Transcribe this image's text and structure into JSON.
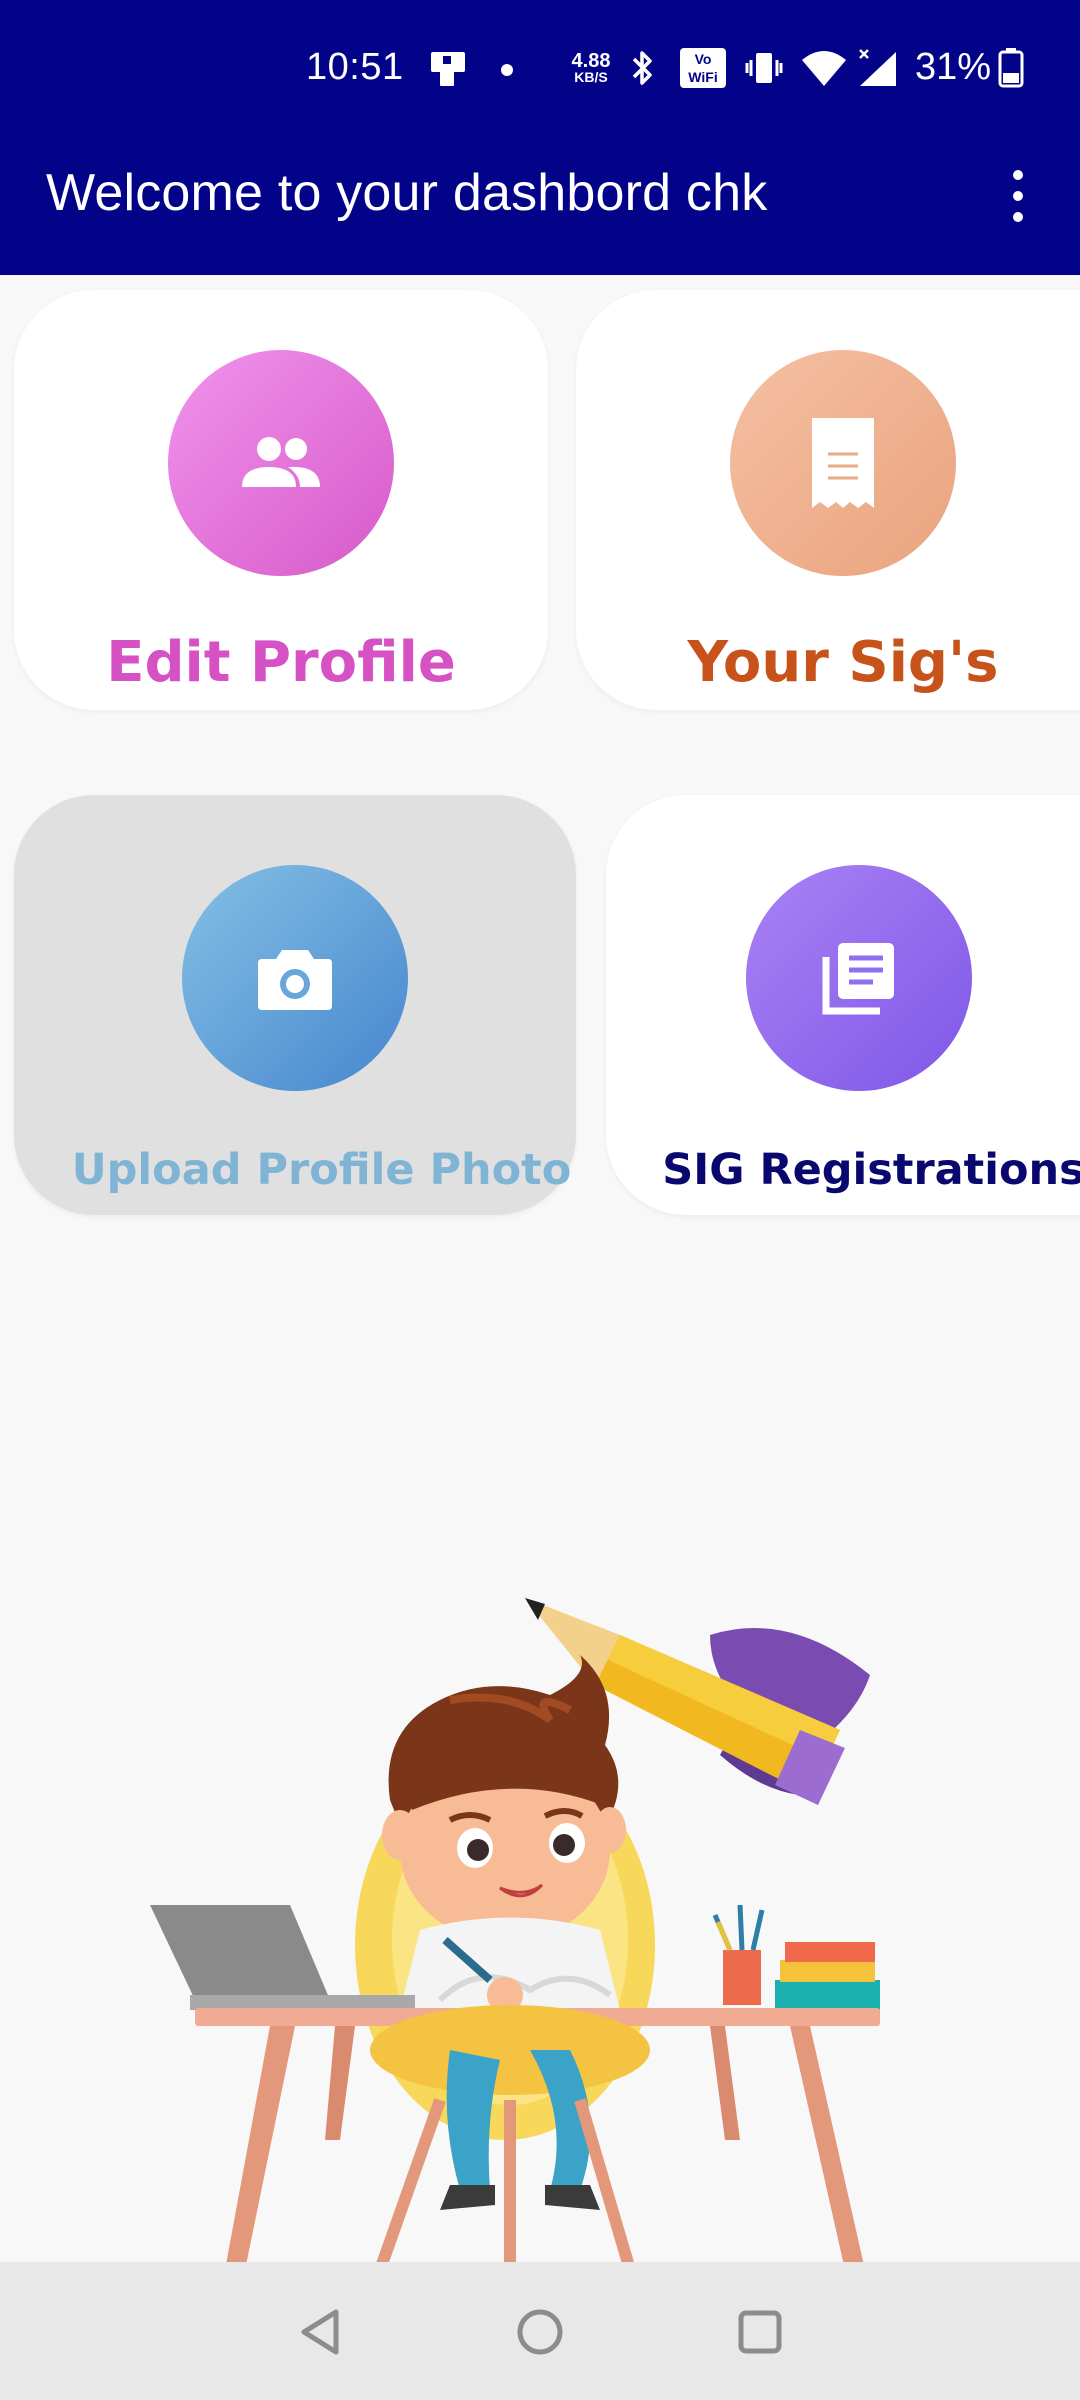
{
  "status_bar": {
    "time": "10:51",
    "network_speed_value": "4.88",
    "network_speed_unit": "KB/S",
    "vowifi_label_top": "Vo",
    "vowifi_label_bottom": "WiFi",
    "battery_percent": "31%"
  },
  "app_bar": {
    "title": "Welcome to your dashbord chk",
    "menu_icon": "overflow-menu-icon"
  },
  "dashboard": {
    "cards": [
      {
        "label": "Edit Profile",
        "icon": "people-icon",
        "label_color": "#d651c3"
      },
      {
        "label": "Your Sig's",
        "icon": "receipt-icon",
        "label_color": "#c7531a"
      },
      {
        "label": "Upload Profile Photo",
        "icon": "camera-icon",
        "label_color": "#7fb4d4"
      },
      {
        "label": "SIG Registrations",
        "icon": "library-books-icon",
        "label_color": "#08086e"
      }
    ]
  },
  "illustration": {
    "icon": "boy-studying-illustration"
  },
  "navigation": {
    "back_icon": "back-triangle-icon",
    "home_icon": "home-circle-icon",
    "recents_icon": "recents-square-icon"
  },
  "colors": {
    "app_bar": "#03038a",
    "background": "#f8f8f8",
    "nav_bar": "#e8e8e8"
  }
}
